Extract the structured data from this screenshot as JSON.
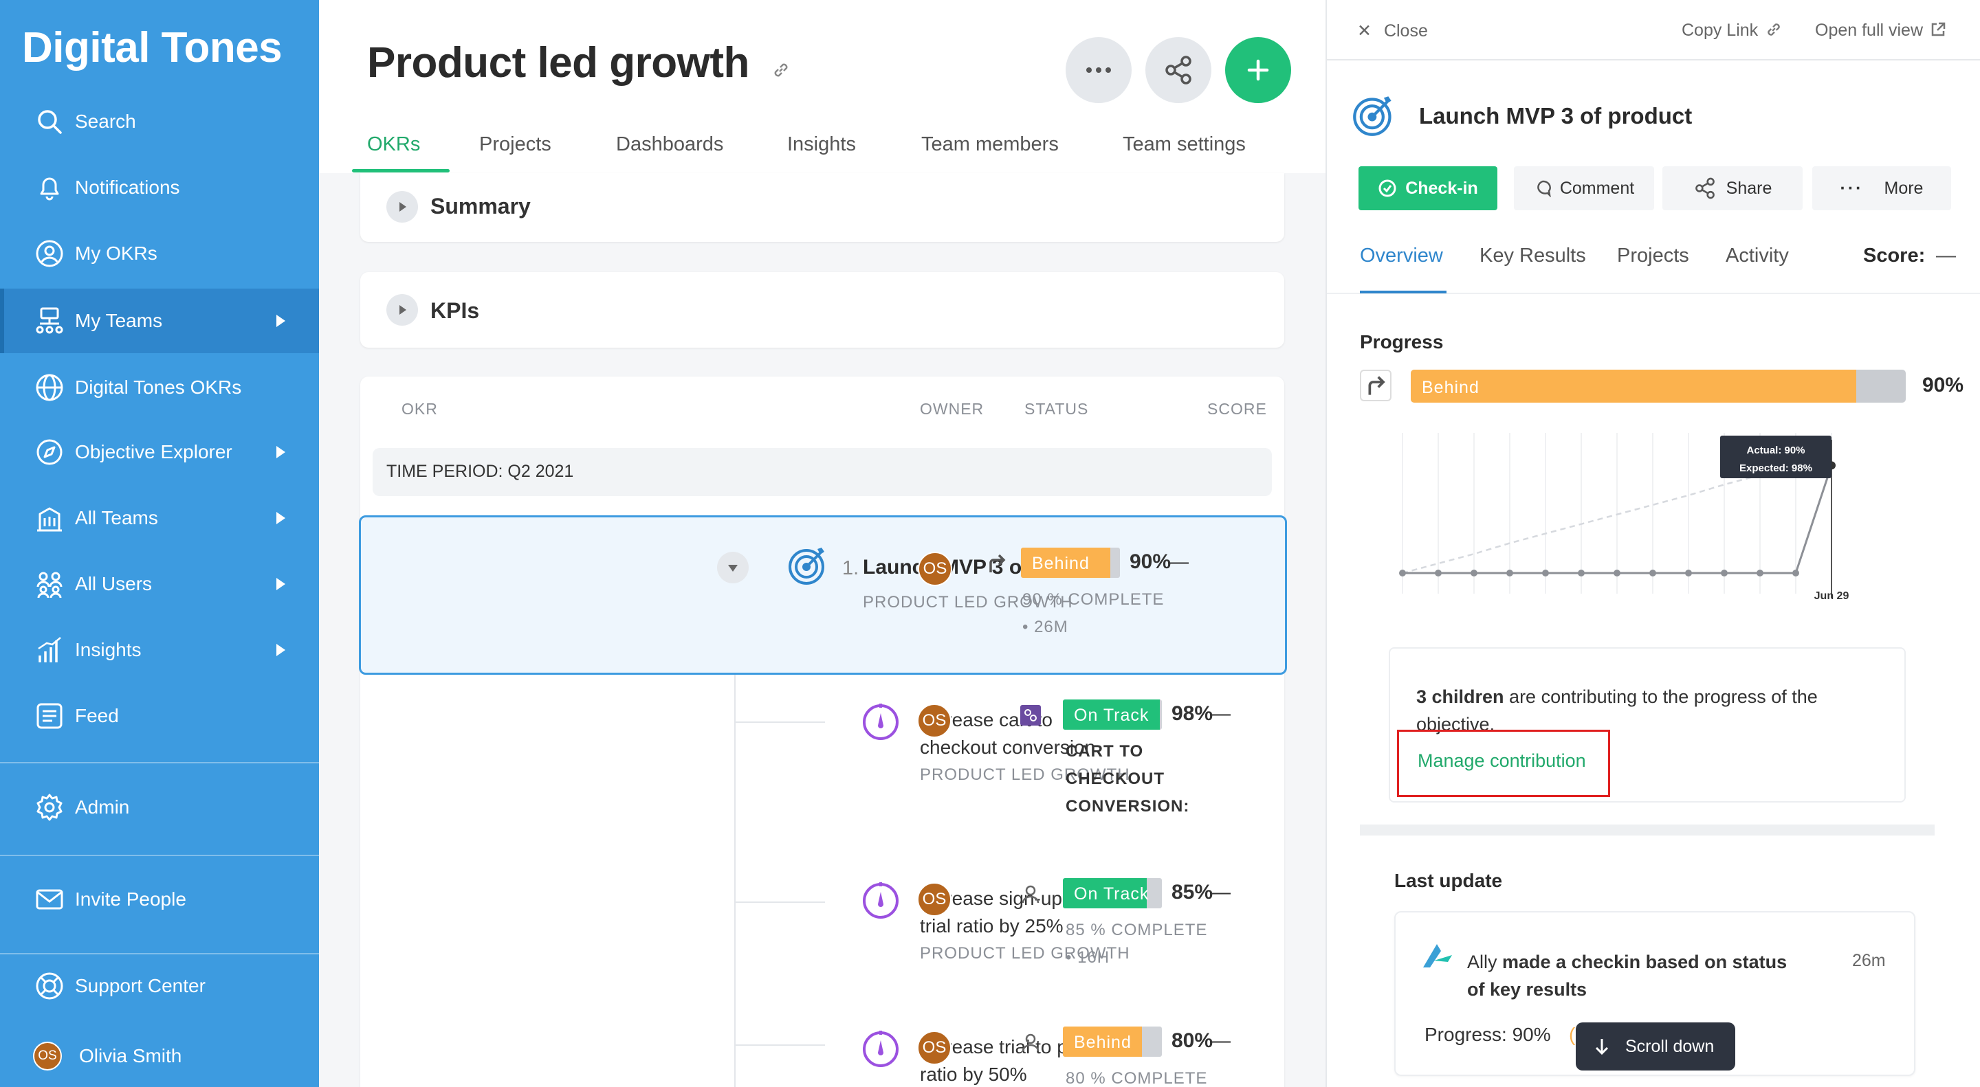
{
  "brand": "Digital Tones",
  "colors": {
    "sidebar": "#3d9be0",
    "accent_green": "#21c07a",
    "behind": "#fbb24e",
    "on_track": "#21c07a",
    "selected_border": "#3d9be0"
  },
  "sidebar": {
    "items": [
      {
        "label": "Search",
        "icon": "search-icon"
      },
      {
        "label": "Notifications",
        "icon": "bell-icon"
      },
      {
        "label": "My OKRs",
        "icon": "user-circle-icon"
      },
      {
        "label": "My Teams",
        "icon": "team-tree-icon",
        "active": true
      },
      {
        "label": "Digital Tones OKRs",
        "icon": "globe-icon"
      },
      {
        "label": "Objective Explorer",
        "icon": "compass-icon"
      },
      {
        "label": "All Teams",
        "icon": "building-icon"
      },
      {
        "label": "All Users",
        "icon": "users-icon"
      },
      {
        "label": "Insights",
        "icon": "bar-chart-icon"
      },
      {
        "label": "Feed",
        "icon": "feed-icon"
      },
      {
        "label": "Admin",
        "icon": "gear-icon"
      },
      {
        "label": "Invite People",
        "icon": "envelope-icon"
      },
      {
        "label": "Support Center",
        "icon": "lifebuoy-icon"
      }
    ],
    "user": {
      "initials": "OS",
      "name": "Olivia Smith"
    }
  },
  "main": {
    "title": "Product led growth",
    "tabs": [
      "OKRs",
      "Projects",
      "Dashboards",
      "Insights",
      "Team members",
      "Team settings"
    ],
    "sections": {
      "summary": "Summary",
      "kpis": "KPIs"
    },
    "columns": {
      "okr": "OKR",
      "owner": "OWNER",
      "status": "STATUS",
      "score": "SCORE"
    },
    "time_period": "TIME PERIOD: Q2 2021",
    "objective": {
      "number": "1.",
      "title": "Launch MVP 3 of product",
      "team": "PRODUCT LED GROWTH",
      "owner": "OS",
      "status": "Behind",
      "progress": 0.9,
      "pct": "90%",
      "score": "—",
      "complete": "90 % COMPLETE",
      "updated": "• 26M"
    },
    "key_results": [
      {
        "title_l1": "Increase cart to",
        "title_l2": "checkout conversion",
        "team": "PRODUCT LED GROWTH",
        "owner": "OS",
        "status": "On Track",
        "progress": 0.98,
        "pct": "98%",
        "score": "—",
        "sub1": "CART TO",
        "sub2": "CHECKOUT",
        "sub3": "CONVERSION:"
      },
      {
        "title_l1": "Increase sign-up to",
        "title_l2": "trial ratio by 25%",
        "team": "PRODUCT LED GROWTH",
        "owner": "OS",
        "status": "On Track",
        "progress": 0.85,
        "pct": "85%",
        "score": "—",
        "sub1": "85 % COMPLETE",
        "sub2": "• 16H"
      },
      {
        "title_l1": "Increase trial to paid",
        "title_l2": "ratio by 50%",
        "owner": "OS",
        "status": "Behind",
        "progress": 0.8,
        "pct": "80%",
        "score": "—",
        "sub1": "80 % COMPLETE"
      }
    ]
  },
  "panel": {
    "close": "Close",
    "copy_link": "Copy Link",
    "open_full": "Open full view",
    "title": "Launch MVP 3 of product",
    "buttons": {
      "checkin": "Check-in",
      "comment": "Comment",
      "share": "Share",
      "more": "More"
    },
    "tabs": [
      "Overview",
      "Key Results",
      "Projects",
      "Activity"
    ],
    "score_label": "Score:",
    "score_value": "—",
    "progress_heading": "Progress",
    "progress_status": "Behind",
    "progress": 0.9,
    "progress_pct": "90%",
    "chart": {
      "tooltip_actual": "Actual: 90%",
      "tooltip_expected": "Expected: 98%",
      "x_label": "Jun 29"
    },
    "contrib_bold": "3 children",
    "contrib_text_l1": " are contributing to the progress of the",
    "contrib_text_l2": "objective.",
    "manage": "Manage contribution",
    "last_update_heading": "Last update",
    "update_actor": "Ally",
    "update_text_l1": " made a checkin based on status",
    "update_text_l2": "of key results",
    "update_time": "26m",
    "update_progress": "Progress: 90%",
    "update_paren": "(",
    "scroll_down": "Scroll down"
  },
  "chart_data": {
    "type": "line",
    "x": [
      "",
      "",
      "",
      "",
      "",
      "",
      "",
      "",
      "",
      "",
      "",
      "",
      "Jun 29"
    ],
    "series": [
      {
        "name": "Actual",
        "values": [
          0,
          0,
          0,
          0,
          0,
          0,
          0,
          0,
          0,
          0,
          0,
          0,
          90
        ]
      },
      {
        "name": "Expected",
        "values": [
          0,
          8,
          16,
          25,
          33,
          41,
          49,
          57,
          65,
          74,
          82,
          90,
          98
        ]
      }
    ],
    "ylim": [
      0,
      100
    ]
  }
}
